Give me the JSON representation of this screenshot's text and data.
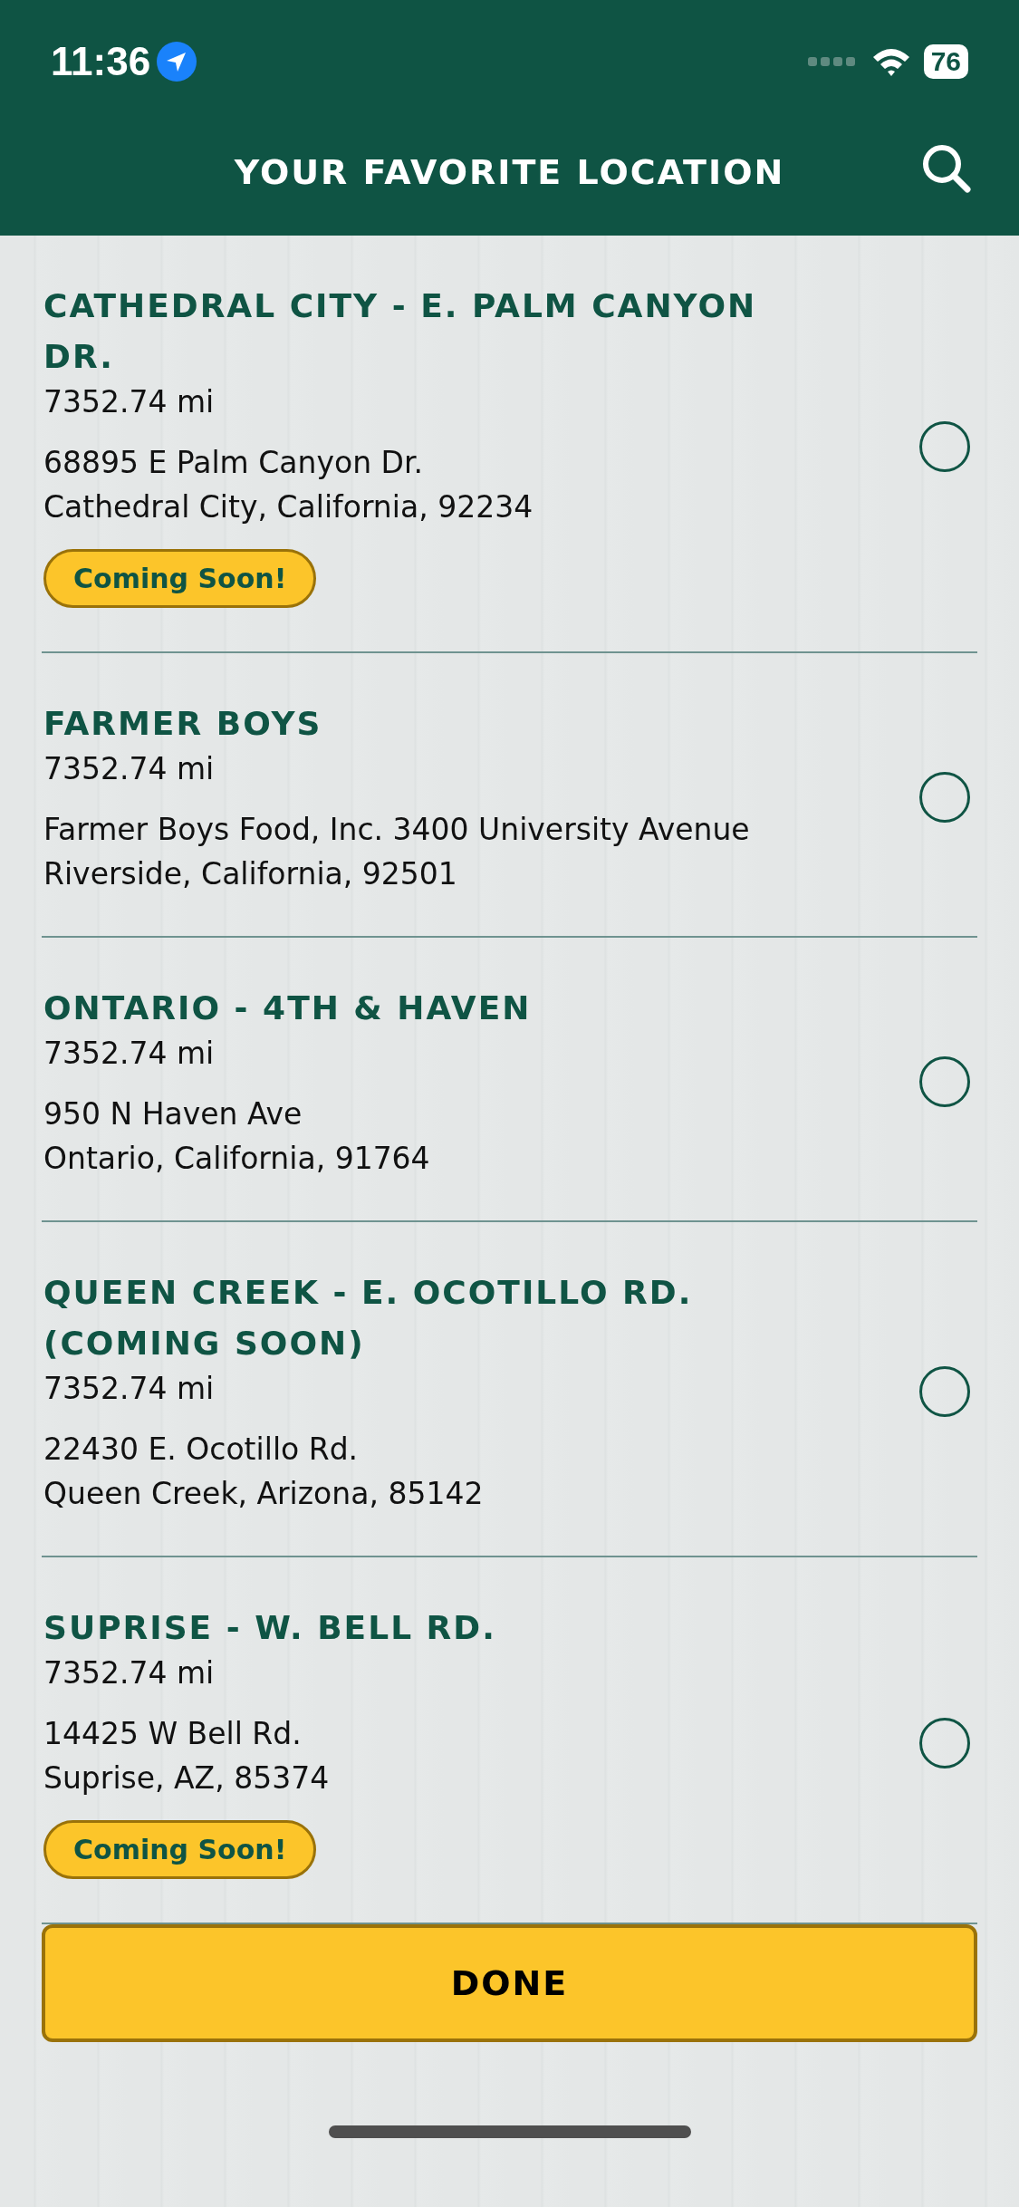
{
  "status_bar": {
    "time": "11:36",
    "battery": "76"
  },
  "header": {
    "title": "YOUR FAVORITE LOCATION"
  },
  "locations": [
    {
      "name": "CATHEDRAL CITY - E. PALM CANYON DR.",
      "distance": "7352.74 mi",
      "address_line_1": "68895 E Palm Canyon Dr.",
      "address_line_2": "Cathedral City, California, 92234",
      "badge": "Coming Soon!",
      "selected": false
    },
    {
      "name": "FARMER BOYS",
      "distance": "7352.74 mi",
      "address_line_1": "Farmer Boys Food, Inc. 3400 University Avenue",
      "address_line_2": "Riverside, California, 92501",
      "selected": false
    },
    {
      "name": "ONTARIO - 4TH & HAVEN",
      "distance": "7352.74 mi",
      "address_line_1": "950 N Haven Ave",
      "address_line_2": "Ontario, California, 91764",
      "selected": false
    },
    {
      "name": "QUEEN CREEK - E. OCOTILLO RD. (COMING SOON)",
      "distance": "7352.74 mi",
      "address_line_1": "22430 E. Ocotillo Rd.",
      "address_line_2": "Queen Creek, Arizona, 85142",
      "selected": false
    },
    {
      "name": "SUPRISE - W. BELL RD.",
      "distance": "7352.74 mi",
      "address_line_1": "14425 W Bell Rd.",
      "address_line_2": "Suprise, AZ, 85374",
      "badge": "Coming Soon!",
      "selected": false
    }
  ],
  "done_button": "DONE"
}
